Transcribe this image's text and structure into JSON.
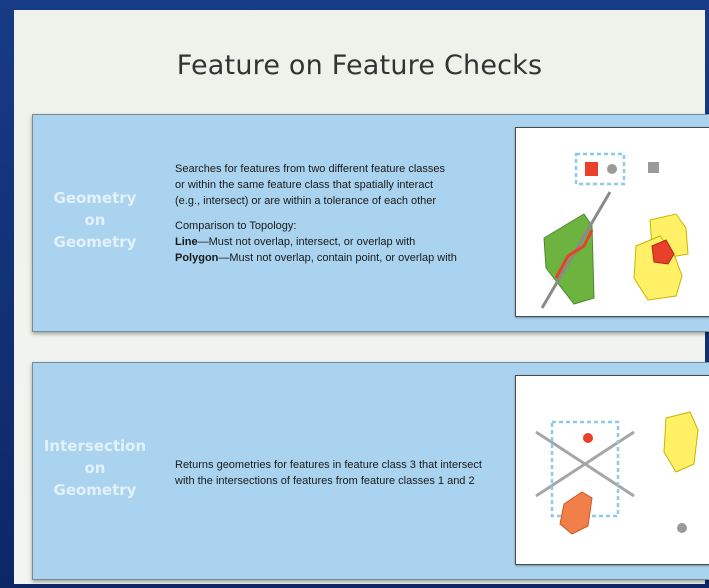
{
  "title": "Feature on Feature Checks",
  "checks": [
    {
      "label": [
        "Geometry",
        "on",
        "Geometry"
      ],
      "description": [
        "Searches for features from two different feature classes",
        "or within the same feature class that spatially interact",
        "(e.g., intersect) or are within a tolerance of each other"
      ],
      "comparison_heading": "Comparison to Topology:",
      "comparison": [
        {
          "term": "Line",
          "text": "—Must not overlap, intersect, or overlap with"
        },
        {
          "term": "Polygon",
          "text": "—Must not overlap, contain point, or overlap with"
        }
      ]
    },
    {
      "label": [
        "Intersection",
        "on",
        "Geometry"
      ],
      "description": [
        "Returns geometries for features in feature class 3 that intersect",
        "with the intersections of features from feature classes 1 and 2"
      ]
    }
  ],
  "colors": {
    "panel": "#a9d3ee",
    "green_polygon": "#6db33f",
    "yellow_polygon": "#fff066",
    "red": "#e8402a",
    "orange_polygon": "#f07f4a",
    "dashed_box": "#8ec9ea",
    "gray": "#9a9a9a"
  }
}
